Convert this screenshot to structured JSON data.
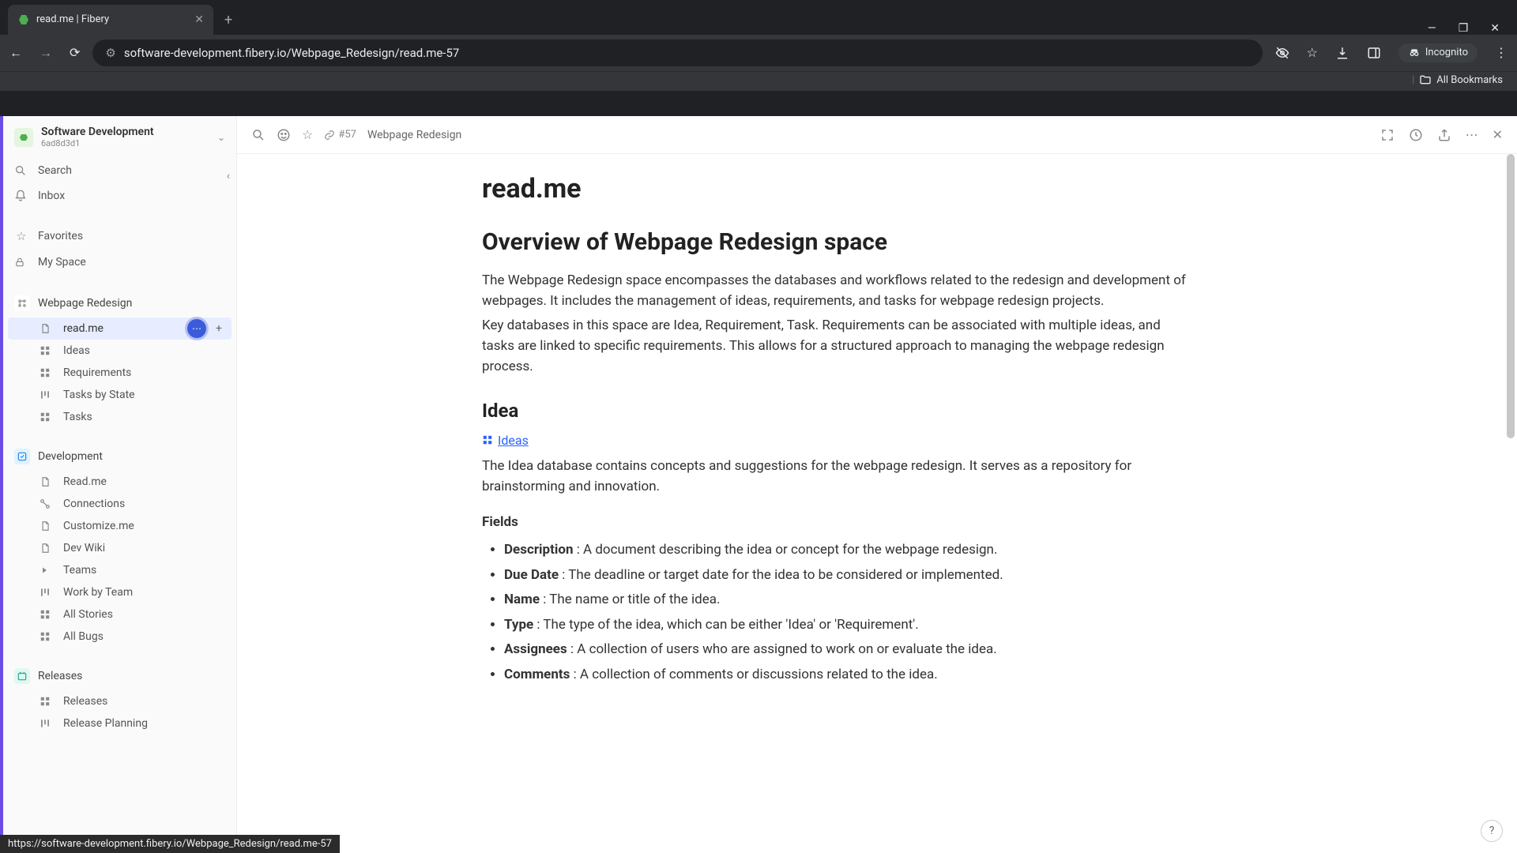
{
  "browser": {
    "tab_title": "read.me | Fibery",
    "url": "software-development.fibery.io/Webpage_Redesign/read.me-57",
    "incognito_label": "Incognito",
    "all_bookmarks": "All Bookmarks",
    "status_url": "https://software-development.fibery.io/Webpage_Redesign/read.me-57"
  },
  "workspace": {
    "name": "Software Development",
    "id": "6ad8d3d1"
  },
  "sidebar": {
    "search": "Search",
    "inbox": "Inbox",
    "favorites": "Favorites",
    "my_space": "My Space",
    "spaces": [
      {
        "name": "Webpage Redesign",
        "icon_color": "#fff",
        "children": [
          {
            "label": "read.me",
            "icon": "doc",
            "active": true
          },
          {
            "label": "Ideas",
            "icon": "grid"
          },
          {
            "label": "Requirements",
            "icon": "grid"
          },
          {
            "label": "Tasks by State",
            "icon": "board"
          },
          {
            "label": "Tasks",
            "icon": "grid"
          }
        ]
      },
      {
        "name": "Development",
        "icon_color": "#e0f2ff",
        "icon_text_color": "#1e88e5",
        "children": [
          {
            "label": "Read.me",
            "icon": "doc"
          },
          {
            "label": "Connections",
            "icon": "connections"
          },
          {
            "label": "Customize.me",
            "icon": "doc"
          },
          {
            "label": "Dev Wiki",
            "icon": "doc"
          },
          {
            "label": "Teams",
            "icon": "caret"
          },
          {
            "label": "Work by Team",
            "icon": "board"
          },
          {
            "label": "All Stories",
            "icon": "grid"
          },
          {
            "label": "All Bugs",
            "icon": "grid"
          }
        ]
      },
      {
        "name": "Releases",
        "icon_color": "#e0f9f0",
        "icon_text_color": "#26a69a",
        "children": [
          {
            "label": "Releases",
            "icon": "grid"
          },
          {
            "label": "Release Planning",
            "icon": "board"
          }
        ]
      }
    ]
  },
  "toolbar": {
    "doc_number": "#57",
    "breadcrumb": "Webpage Redesign"
  },
  "document": {
    "title": "read.me",
    "h2_overview": "Overview of Webpage Redesign space",
    "overview_p1": "The Webpage Redesign space encompasses the databases and workflows related to the redesign and development of webpages. It includes the management of ideas, requirements, and tasks for webpage redesign projects.",
    "overview_p2": "Key databases in this space are Idea, Requirement, Task. Requirements can be associated with multiple ideas, and tasks are linked to specific requirements. This allows for a structured approach to managing the webpage redesign process.",
    "h3_idea": "Idea",
    "ideas_link": "Ideas",
    "idea_desc": "The Idea database contains concepts and suggestions for the webpage redesign. It serves as a repository for brainstorming and innovation.",
    "fields_label": "Fields",
    "fields": [
      {
        "name": "Description",
        "desc": " : A document describing the idea or concept for the webpage redesign."
      },
      {
        "name": "Due Date",
        "desc": " : The deadline or target date for the idea to be considered or implemented."
      },
      {
        "name": "Name",
        "desc": " : The name or title of the idea."
      },
      {
        "name": "Type",
        "desc": " : The type of the idea, which can be either 'Idea' or 'Requirement'."
      },
      {
        "name": "Assignees",
        "desc": " : A collection of users who are assigned to work on or evaluate the idea."
      },
      {
        "name": "Comments",
        "desc": " : A collection of comments or discussions related to the idea."
      }
    ]
  },
  "help_label": "?"
}
